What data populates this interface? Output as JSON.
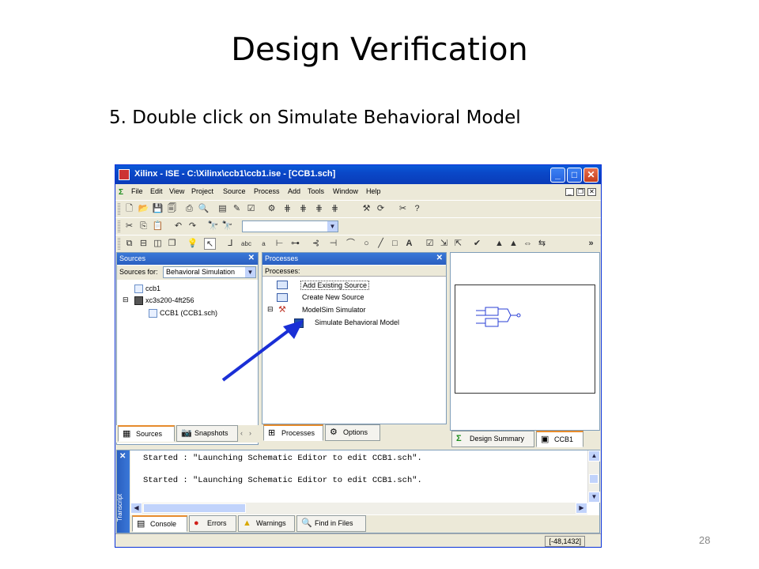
{
  "slide": {
    "title": "Design Verification",
    "step": "5.  Double click on Simulate Behavioral Model",
    "page_number": "28"
  },
  "window": {
    "title": "Xilinx - ISE - C:\\Xilinx\\ccb1\\ccb1.ise - [CCB1.sch]",
    "min_label": "_",
    "max_label": "□",
    "close_label": "✕"
  },
  "menu": {
    "items": [
      "File",
      "Edit",
      "View",
      "Project",
      "Source",
      "Process",
      "Add",
      "Tools",
      "Window",
      "Help"
    ]
  },
  "sources_panel": {
    "title": "Sources",
    "sources_for_label": "Sources for:",
    "sources_for_value": "Behavioral Simulation",
    "tree": [
      "ccb1",
      "xc3s200-4ft256",
      "CCB1 (CCB1.sch)"
    ],
    "tabs": [
      "Sources",
      "Snapshots"
    ]
  },
  "processes_panel": {
    "title": "Processes",
    "header": "Processes:",
    "items": [
      "Add Existing Source",
      "Create New Source",
      "ModelSim Simulator",
      "Simulate Behavioral Model"
    ],
    "tabs": [
      "Processes",
      "Options"
    ]
  },
  "editor_tabs": [
    "Design Summary",
    "CCB1"
  ],
  "console": {
    "lines": [
      "Started : \"Launching Schematic Editor to edit CCB1.sch\".",
      "Started : \"Launching Schematic Editor to edit CCB1.sch\"."
    ],
    "side_label": "Transcript",
    "tabs": [
      "Console",
      "Errors",
      "Warnings",
      "Find in Files"
    ]
  },
  "status": {
    "coords": "[-48,1432]"
  },
  "colors": {
    "titlebar": "#0a48c8",
    "arrow": "#1a2fd6",
    "tab_highlight": "#e68b2c"
  }
}
